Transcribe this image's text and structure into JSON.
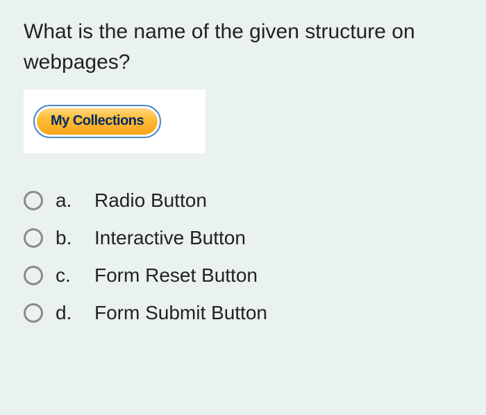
{
  "question": "What is the name of the given structure on webpages?",
  "example_button_label": "My Collections",
  "options": [
    {
      "letter": "a.",
      "text": "Radio Button"
    },
    {
      "letter": "b.",
      "text": "Interactive Button"
    },
    {
      "letter": "c.",
      "text": "Form Reset Button"
    },
    {
      "letter": "d.",
      "text": "Form Submit Button"
    }
  ]
}
